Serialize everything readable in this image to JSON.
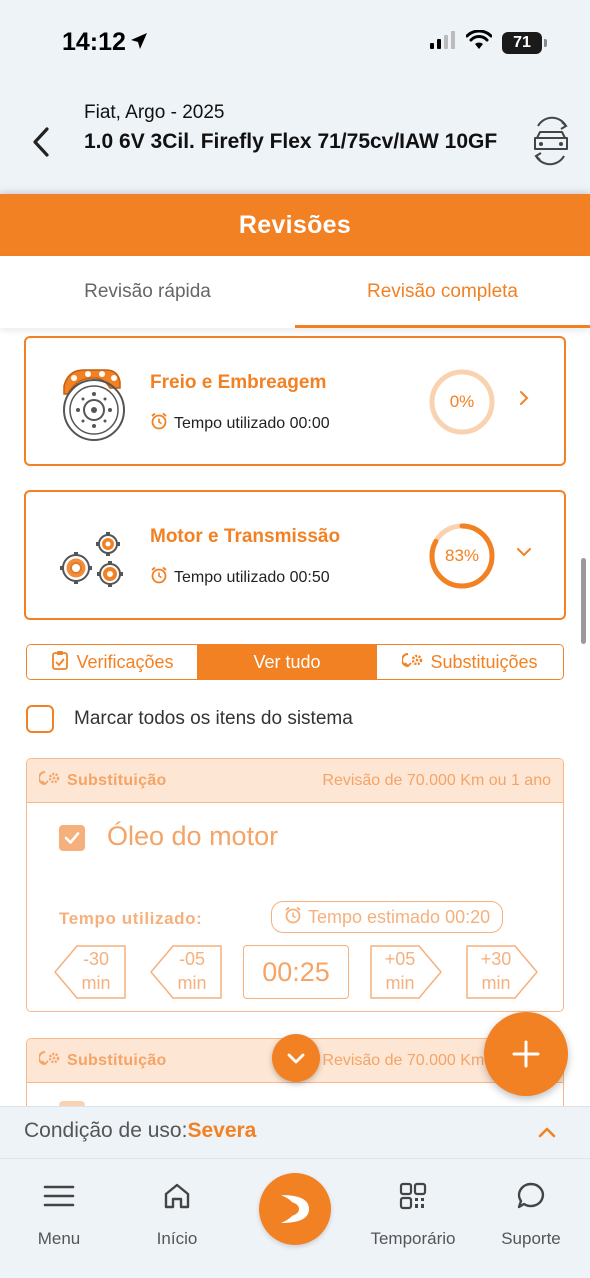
{
  "status_bar": {
    "time": "14:12",
    "battery": "71"
  },
  "vehicle": {
    "subtitle": "Fiat, Argo - 2025",
    "title": "1.0 6V 3Cil. Firefly Flex 71/75cv/IAW 10GF"
  },
  "page_title": "Revisões",
  "tabs": [
    {
      "label": "Revisão rápida",
      "active": false
    },
    {
      "label": "Revisão completa",
      "active": true
    }
  ],
  "systems": [
    {
      "name": "Freio e Embreagem",
      "time_label": "Tempo utilizado 00:00",
      "progress_text": "0%",
      "progress": 0,
      "icon": "brake-disc-icon",
      "expanded": false
    },
    {
      "name": "Motor e Transmissão",
      "time_label": "Tempo utilizado 00:50",
      "progress_text": "83%",
      "progress": 0.83,
      "icon": "gears-icon",
      "expanded": true
    }
  ],
  "filters": [
    {
      "label": "Verificações",
      "active": false,
      "icon": "clipboard-check-icon"
    },
    {
      "label": "Ver tudo",
      "active": true
    },
    {
      "label": "Substituições",
      "active": false,
      "icon": "replace-gear-icon"
    }
  ],
  "mark_all_label": "Marcar todos os itens do sistema",
  "items": [
    {
      "type": "Substituição",
      "revision": "Revisão de 70.000 Km ou 1 ano",
      "name": "Óleo do motor",
      "checked": true,
      "time_used_label": "Tempo utilizado:",
      "estimated": "Tempo estimado 00:20",
      "current_time": "00:25",
      "steppers": [
        {
          "value": "-30",
          "unit": "min"
        },
        {
          "value": "-05",
          "unit": "min"
        },
        {
          "value": "+05",
          "unit": "min"
        },
        {
          "value": "+30",
          "unit": "min"
        }
      ]
    },
    {
      "type": "Substituição",
      "revision": "Revisão de 70.000 Km ou 1 ano"
    }
  ],
  "usage": {
    "label": "Condição de uso:",
    "value": "Severa"
  },
  "nav": [
    {
      "label": "Menu",
      "icon": "hamburger-icon"
    },
    {
      "label": "Início",
      "icon": "home-icon"
    },
    {
      "label": "Temporário",
      "icon": "qr-code-icon"
    },
    {
      "label": "Suporte",
      "icon": "chat-bubble-icon"
    }
  ],
  "colors": {
    "accent": "#f28123",
    "accent_light": "#f6b07c",
    "header_bg": "#eef3f8"
  }
}
